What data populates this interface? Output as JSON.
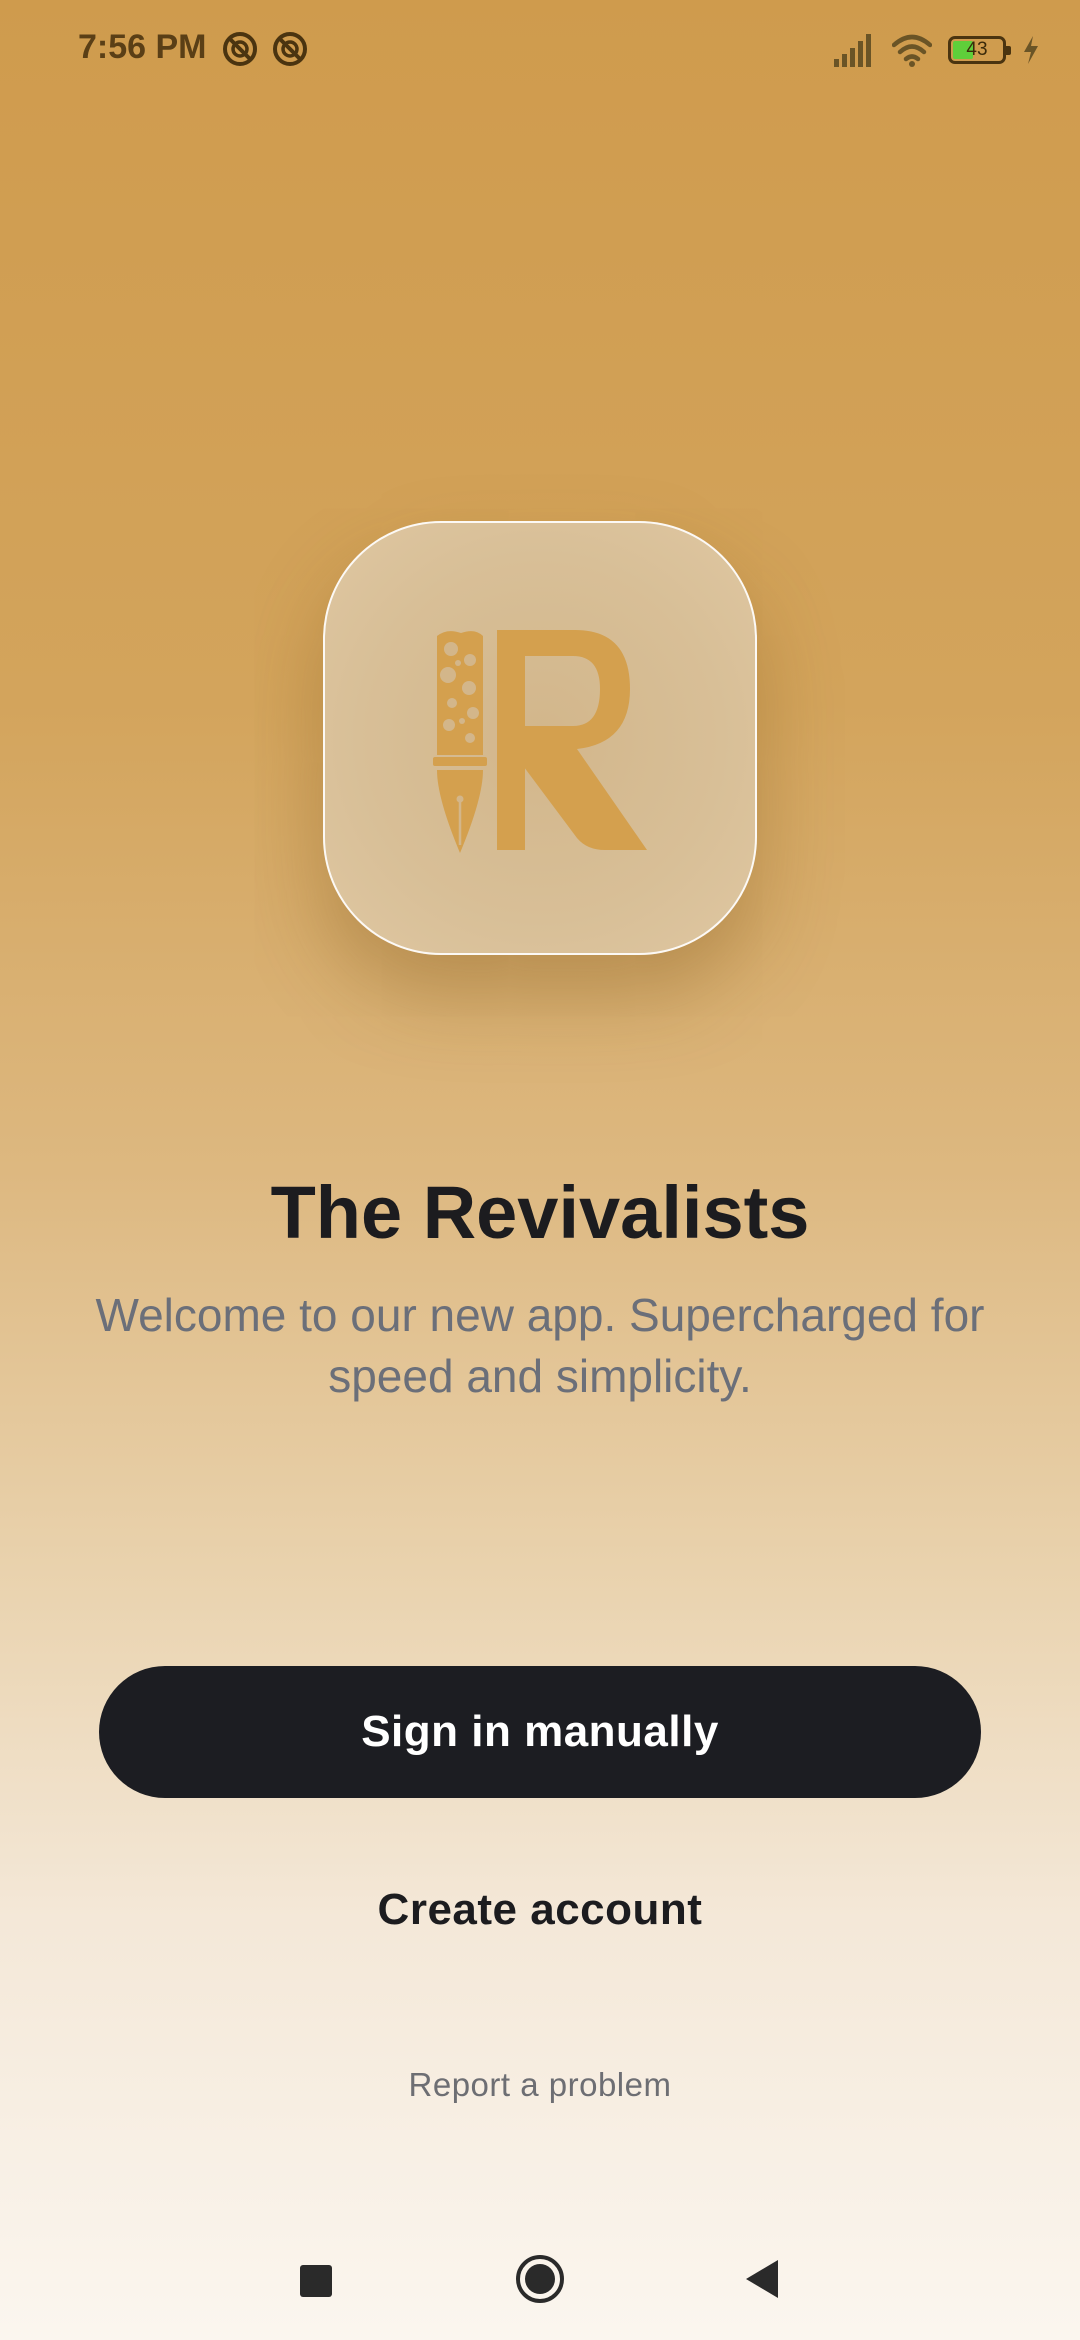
{
  "status_bar": {
    "time": "7:56 PM",
    "battery_level": "43",
    "battery_charging": true,
    "icons": [
      "dnd-icon",
      "dnd-icon",
      "signal-icon",
      "wifi-icon",
      "battery-icon",
      "charging-bolt-icon"
    ]
  },
  "app": {
    "logo_name": "pen-r-logo-icon",
    "title": "The Revivalists",
    "subtitle": "Welcome to our new app. Supercharged for speed and simplicity."
  },
  "actions": {
    "sign_in_label": "Sign in manually",
    "create_account_label": "Create account",
    "report_label": "Report a problem"
  },
  "nav_bar": {
    "icons": [
      "recents-square-icon",
      "home-circle-icon",
      "back-triangle-icon"
    ]
  },
  "colors": {
    "accent": "#d4a04e",
    "primary_button": "#1c1d22",
    "title_text": "#1c1c1f",
    "subtitle_text": "#6b6f79"
  }
}
